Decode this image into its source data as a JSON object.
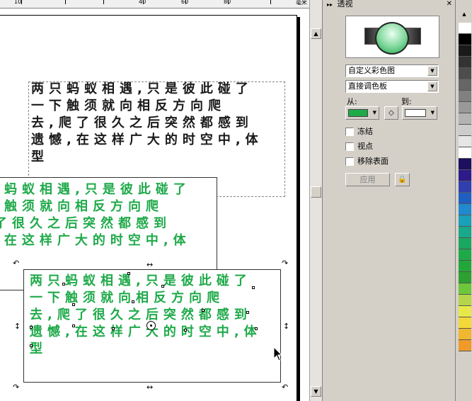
{
  "ruler": {
    "ticks": [
      "10",
      "40",
      "60",
      "80"
    ],
    "unit": "毫米"
  },
  "canvas": {
    "text_lines": [
      "两只蚂蚁相遇,只是彼此碰了",
      "一下触须就向相反方向爬",
      "去,爬了很久之后突然都感到",
      "遗憾,在这样广大的时空中,体",
      "型"
    ],
    "green_lines": [
      "蚂蚁相遇,只是彼此碰了",
      "触须就向相反方向爬",
      "了很久之后突然都感到",
      ",在这样广大的时空中,体"
    ],
    "text_color": "#1a1a1a",
    "fill_color": "#1faa4a"
  },
  "docker": {
    "title": "透视",
    "palette_dropdown": "自定义彩色图",
    "blend_dropdown": "直接调色板",
    "from_label": "从:",
    "to_label": "到:",
    "from_color": "#1faa4a",
    "to_color": "#ffffff",
    "checks": [
      {
        "label": "冻结"
      },
      {
        "label": "视点"
      },
      {
        "label": "移除表面"
      }
    ],
    "apply_label": "应用"
  },
  "palette": {
    "colors": [
      "#ffffff",
      "#000000",
      "#1a1a1a",
      "#333333",
      "#4d4d4d",
      "#666666",
      "#808080",
      "#999999",
      "#b3b3b3",
      "#cccccc",
      "#e6e6e6",
      "#ffffff",
      "#1b0f5e",
      "#2e1a8a",
      "#2f3fb0",
      "#1f5fc4",
      "#1f8ad0",
      "#1aa0b8",
      "#19a88a",
      "#1aa860",
      "#1faa4a",
      "#22a83a",
      "#2ca030",
      "#6cc83a",
      "#b5d64a",
      "#e8e84a",
      "#f4d83a",
      "#f0b830",
      "#f09a2a"
    ]
  }
}
